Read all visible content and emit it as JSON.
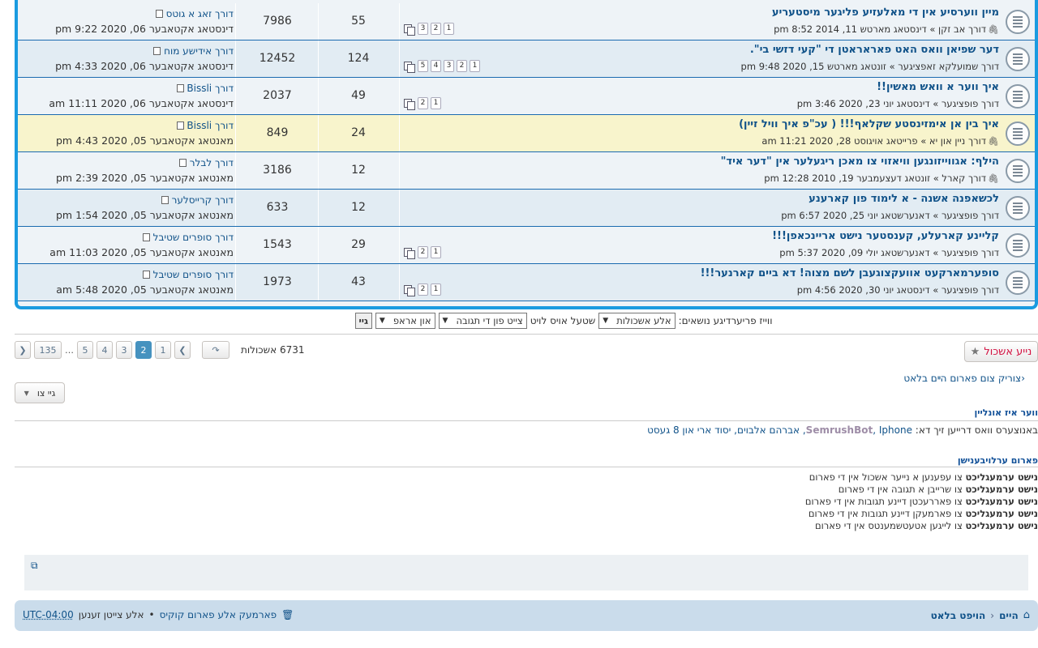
{
  "topics": [
    {
      "title": "מיין ווערסיע אין די מאלעזיע פליגער מיסטעריע",
      "attach": "🖇",
      "meta": "דורך אב זקן » דינסטאג מארטש 11, 2014 8:52 pm",
      "pages": [
        "3",
        "2",
        "1"
      ],
      "replies": "55",
      "views": "7986",
      "last_by": "דורך זאג א גוטס",
      "last_date": "דינסטאג אקטאבער 06, 2020 9:22 pm",
      "style": "normal"
    },
    {
      "title": "דער שפיאן וואס האט פאראראטן די \"קעי דזשי בי\".",
      "attach": "",
      "meta": "דורך שמועלקא זאפציגער » זונטאג מארטש 15, 2020 9:48 pm",
      "pages": [
        "5",
        "4",
        "3",
        "2",
        "1"
      ],
      "replies": "124",
      "views": "12452",
      "last_by": "דורך אידישע מוח",
      "last_date": "דינסטאג אקטאבער 06, 2020 4:33 pm",
      "style": "alt"
    },
    {
      "title": "איך ווער א וואש מאשין!!",
      "attach": "",
      "meta": "דורך פופציגער » דינסטאג יוני 23, 2020 3:46 pm",
      "pages": [
        "2",
        "1"
      ],
      "replies": "49",
      "views": "2037",
      "last_by": "דורך Bissli",
      "last_date": "דינסטאג אקטאבער 06, 2020 11:11 am",
      "style": "normal"
    },
    {
      "title": "איך בין אן אימזינסטע שקלאף!!! ( עכ\"פ איך וויל זיין)",
      "attach": "🖇",
      "meta": "דורך ניין און יא » פרייטאג אויגוסט 28, 2020 11:21 am",
      "pages": [],
      "replies": "24",
      "views": "849",
      "last_by": "דורך Bissli",
      "last_date": "מאנטאג אקטאבער 05, 2020 4:43 pm",
      "style": "sticky"
    },
    {
      "title": "הילף: אגווייזונגען וויאזוי צו מאכן ריגעלער אין \"דער איד\"",
      "attach": "🖇",
      "meta": "דורך קארל » זונטאג דעצעמבער 19, 2010 12:28 pm",
      "pages": [],
      "replies": "12",
      "views": "3186",
      "last_by": "דורך לבלר",
      "last_date": "מאנטאג אקטאבער 05, 2020 2:39 pm",
      "style": "normal"
    },
    {
      "title": "לכשאפנה אשנה - א לימוד פון קארענע",
      "attach": "",
      "meta": "דורך פופציגער » דאנערשטאג יוני 25, 2020 6:57 pm",
      "pages": [],
      "replies": "12",
      "views": "633",
      "last_by": "דורך קרייסלער",
      "last_date": "מאנטאג אקטאבער 05, 2020 1:54 pm",
      "style": "alt"
    },
    {
      "title": "קליינע קארעלע, קענסטער נישט אריינכאפן!!!",
      "attach": "",
      "meta": "דורך פופציגער » דאנערשטאג יולי 09, 2020 5:37 pm",
      "pages": [
        "2",
        "1"
      ],
      "replies": "29",
      "views": "1543",
      "last_by": "דורך סופרים שטיבל",
      "last_date": "מאנטאג אקטאבער 05, 2020 11:03 am",
      "style": "normal"
    },
    {
      "title": "סופערמארקעט אוועקצוגעבן לשם מצוה! דא ביים קארנער!!!",
      "attach": "",
      "meta": "דורך פופציגער » דינסטאג יוני 30, 2020 4:56 pm",
      "pages": [
        "2",
        "1"
      ],
      "replies": "43",
      "views": "1973",
      "last_by": "דורך סופרים שטיבל",
      "last_date": "מאנטאג אקטאבער 05, 2020 5:48 am",
      "style": "alt"
    }
  ],
  "sortbar": {
    "label": "ווייז פריערדיגע נושאים:",
    "days_value": "אלע אשכולות",
    "sort_label": "שטעל אויס לויט",
    "sort_value": "צייט פון די תגובה",
    "dir_value": "און אראפ",
    "go": "גיי"
  },
  "actions": {
    "new_topic": "נייע אשכול",
    "topic_count": "6731 אשכולות",
    "pages": [
      "1",
      "2",
      "3",
      "4",
      "5"
    ],
    "current_page": "2",
    "last_page": "135",
    "dots": "…",
    "back_link": "צוריק צום פארום הײם בלאט",
    "jump": "גיי צו"
  },
  "online": {
    "heading": "ווער איז אונליין",
    "prefix": "באנוצערס וואס דרייען זיך דא:",
    "bot": "SemrushBot",
    "users": ", Iphone, אברהם אלבוים, יסוד ארי און 8 געסט"
  },
  "permissions": {
    "heading": "פארום ערלויבענישן",
    "lines": [
      {
        "bold": "נישט ערמעגליכט",
        "text": " צו עפענען א נייער אשכול אין די פארום"
      },
      {
        "bold": "נישט ערמעגליכט",
        "text": " צו שרייבן א תגובה אין די פארום"
      },
      {
        "bold": "נישט ערמעגליכט",
        "text": " צו פאררעכטן דיינע תגובות אין די פארום"
      },
      {
        "bold": "נישט ערמעגליכט",
        "text": " צו פארמעקן דיינע תגובות אין די פארום"
      },
      {
        "bold": "נישט ערמעגליכט",
        "text": " צו לייגען אטעטשמענטס אין די פארום"
      }
    ]
  },
  "footer": {
    "home": "היים",
    "sep": "‹",
    "index": "הויפט בלאט",
    "delete_cookies": "פארמעק אלע פארום קוקיס",
    "dot": "•",
    "tz_prefix": "אלע צייטן זענען",
    "tz": "UTC-04:00"
  },
  "colors": {
    "accent": "#1a9be0",
    "link": "#105289",
    "sticky_bg": "#f8f4cc",
    "new_topic": "#d31141"
  }
}
